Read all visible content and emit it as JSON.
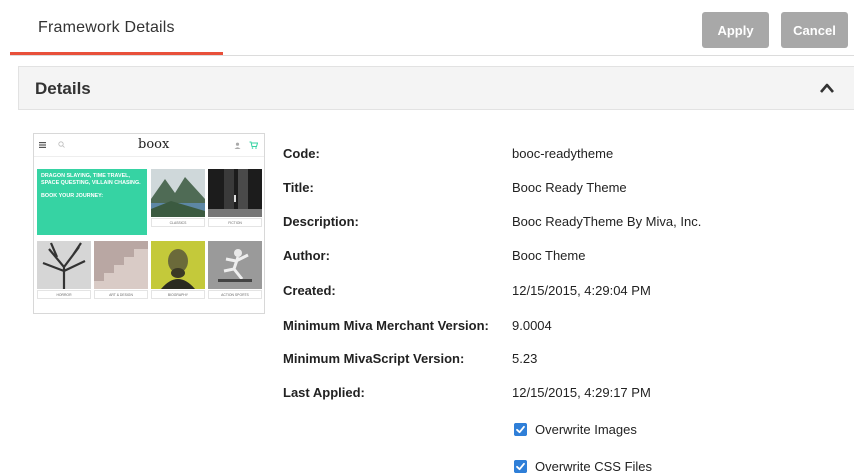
{
  "header": {
    "tab_title": "Framework Details",
    "apply_label": "Apply",
    "cancel_label": "Cancel"
  },
  "section": {
    "title": "Details"
  },
  "thumbnail": {
    "logo": "boox",
    "hero_text": "DRAGON SLAYING, TIME TRAVEL, SPACE QUESTING, VILLAIN CHASING.",
    "hero_cta": "BOOK YOUR JOURNEY:",
    "tiles": [
      "CLASSICS",
      "FICTION",
      "HORROR",
      "ART & DESIGN",
      "BIOGRAPHY",
      "ACTION SPORTS"
    ]
  },
  "details": {
    "code_label": "Code:",
    "code_value": "booc-readytheme",
    "title_label": "Title:",
    "title_value": "Booc Ready Theme",
    "description_label": "Description:",
    "description_value": "Booc ReadyTheme By Miva, Inc.",
    "author_label": "Author:",
    "author_value": "Booc Theme",
    "created_label": "Created:",
    "created_value": "12/15/2015, 4:29:04 PM",
    "min_mm_label": "Minimum Miva Merchant Version:",
    "min_mm_value": "9.0004",
    "min_ms_label": "Minimum MivaScript Version:",
    "min_ms_value": "5.23",
    "last_applied_label": "Last Applied:",
    "last_applied_value": "12/15/2015, 4:29:17 PM"
  },
  "options": {
    "overwrite_images_label": "Overwrite Images",
    "overwrite_images_checked": true,
    "overwrite_css_label": "Overwrite CSS Files",
    "overwrite_css_checked": true
  },
  "colors": {
    "tab_accent": "#e8503a",
    "button_bg": "#a8a8a8",
    "checkbox": "#2f7fd8",
    "hero": "#36d3a3"
  }
}
